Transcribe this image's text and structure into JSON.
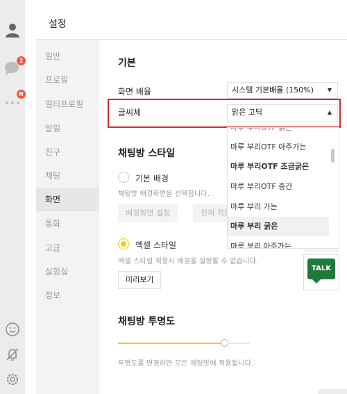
{
  "header": {
    "title": "설정"
  },
  "rail": {
    "chat_badge": "2",
    "more_badge": "N"
  },
  "nav": {
    "items": [
      "일반",
      "프로필",
      "멀티프로필",
      "알림",
      "친구",
      "채팅",
      "화면",
      "통화",
      "고급",
      "실험실",
      "정보"
    ],
    "active_index": 6
  },
  "basic": {
    "title": "기본",
    "zoom_label": "화면 배율",
    "zoom_value": "시스템 기본배율 (150%)",
    "font_label": "글씨체",
    "font_value": "맑은 고딕"
  },
  "font_dropdown": {
    "options": [
      "마루 부리OTF 아주가는",
      "마루 부리OTF 조금굵은",
      "마루 부리OTF 중간",
      "마루 부리 가는",
      "마루 부리 굵은",
      "마루 부리 아주가는"
    ],
    "highlighted_index": 4
  },
  "chat_style": {
    "title": "채팅방 스타일",
    "basic_bg_label": "기본 배경",
    "basic_bg_desc": "채팅방 배경화면을 선택합니다.",
    "bg_setting_button": "배경화면 설정",
    "apply_all_button": "전체 적용",
    "excel_label": "엑셀 스타일",
    "excel_desc": "엑셀 스타일 적용시 배경을 설정할 수 없습니다.",
    "preview_button": "미리보기",
    "thumbnail_text": "TALK"
  },
  "opacity": {
    "title": "채팅방 투명도",
    "desc": "투명도를 변경하면 모든 채팅방에 적용됩니다.",
    "value_fraction": 0.8
  },
  "colors": {
    "accent": "#f6c818",
    "highlight_border": "#cf2b2b",
    "badge": "#f2553f",
    "talk_green": "#1f7a3a"
  }
}
